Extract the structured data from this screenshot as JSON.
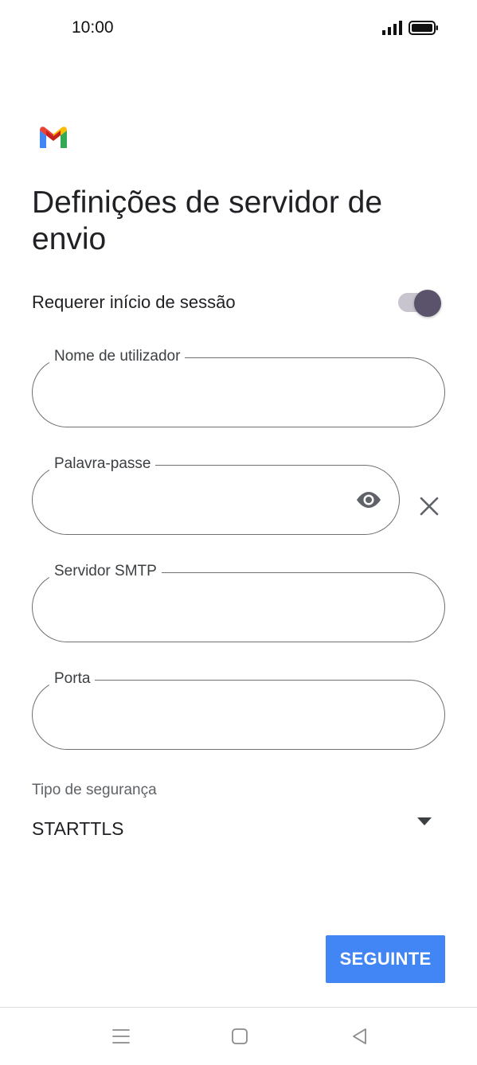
{
  "status_bar": {
    "time": "10:00",
    "signal_icon": "signal-icon",
    "battery_icon": "battery-icon"
  },
  "app": {
    "logo_icon": "gmail-logo",
    "colors": {
      "blue": "#4285f4",
      "red": "#ea4335",
      "yellow": "#fbbc04",
      "green": "#34a853"
    }
  },
  "page": {
    "title": "Definições de servidor de envio"
  },
  "require_signin": {
    "label": "Requerer início de sessão",
    "enabled": true,
    "thumb_color": "#5b536b",
    "track_color": "#c8c5ce"
  },
  "fields": {
    "username": {
      "label": "Nome de utilizador",
      "value": ""
    },
    "password": {
      "label": "Palavra-passe",
      "value": "",
      "visibility_icon": "eye-icon",
      "clear_icon": "close-icon"
    },
    "smtp_server": {
      "label": "Servidor SMTP",
      "value": ""
    },
    "port": {
      "label": "Porta",
      "value": ""
    }
  },
  "security": {
    "label": "Tipo de segurança",
    "selected": "STARTTLS",
    "dropdown_icon": "dropdown-icon"
  },
  "actions": {
    "next_label": "SEGUINTE",
    "next_color": "#4285f4"
  },
  "nav_bar": {
    "menu_icon": "menu-icon",
    "home_icon": "home-icon",
    "back_icon": "back-icon"
  }
}
